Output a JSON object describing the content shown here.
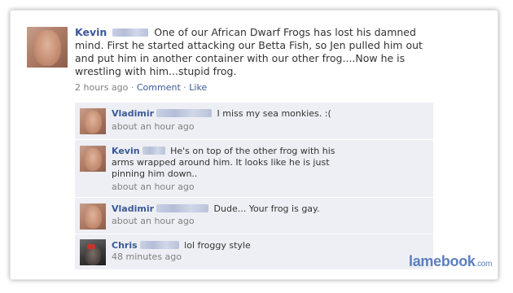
{
  "post": {
    "author": "Kevin",
    "text": "One of our African Dwarf Frogs has lost his damned mind. First he started attacking our Betta Fish, so Jen pulled him out and put him in another container with our other frog....Now he is wrestling with him...stupid frog.",
    "time": "2 hours ago",
    "separator": "·",
    "comment_label": "Comment",
    "like_label": "Like"
  },
  "comments": [
    {
      "author": "Vladimir",
      "text": "I miss my sea monkies. :(",
      "time": "about an hour ago"
    },
    {
      "author": "Kevin",
      "text": "He's on top of the other frog with his arms wrapped around him. It looks like he is just pinning him down..",
      "time": "about an hour ago"
    },
    {
      "author": "Vladimir",
      "text": "Dude... Your frog is gay.",
      "time": "about an hour ago"
    },
    {
      "author": "Chris",
      "text": "lol froggy style",
      "time": "48 minutes ago"
    }
  ],
  "watermark": {
    "brand": "lamebook",
    "tld": ".com"
  },
  "colors": {
    "link": "#3b5998",
    "comment_bg": "#edeff4",
    "meta": "#808080"
  }
}
